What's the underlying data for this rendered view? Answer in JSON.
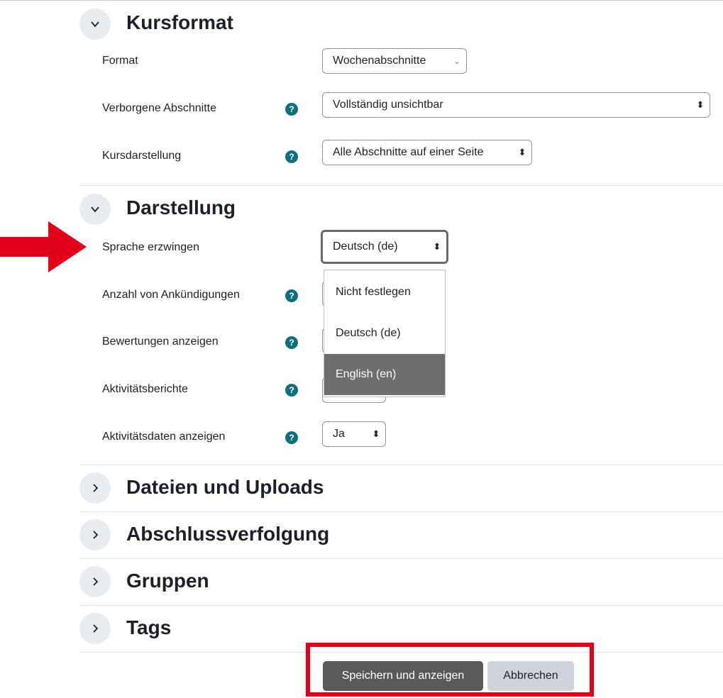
{
  "sections": {
    "kursformat": {
      "title": "Kursformat",
      "expanded": true
    },
    "darstellung": {
      "title": "Darstellung",
      "expanded": true
    },
    "dateien": {
      "title": "Dateien und Uploads",
      "expanded": false
    },
    "abschluss": {
      "title": "Abschlussverfolgung",
      "expanded": false
    },
    "gruppen": {
      "title": "Gruppen",
      "expanded": false
    },
    "tags": {
      "title": "Tags",
      "expanded": false
    }
  },
  "fields": {
    "format": {
      "label": "Format",
      "value": "Wochenabschnitte"
    },
    "verborgene": {
      "label": "Verborgene Abschnitte",
      "value": "Vollständig unsichtbar"
    },
    "kursdarstellung": {
      "label": "Kursdarstellung",
      "value": "Alle Abschnitte auf einer Seite"
    },
    "sprache": {
      "label": "Sprache erzwingen",
      "value": "Deutsch (de)"
    },
    "ankuendigungen": {
      "label": "Anzahl von Ankündigungen"
    },
    "bewertungen": {
      "label": "Bewertungen anzeigen"
    },
    "aktivitaetsberichte": {
      "label": "Aktivitätsberichte"
    },
    "aktivitaetsdaten": {
      "label": "Aktivitätsdaten anzeigen",
      "value": "Ja"
    }
  },
  "language_dropdown": {
    "options": [
      "Nicht festlegen",
      "Deutsch (de)",
      "English (en)"
    ],
    "highlighted": "English (en)"
  },
  "help_icon_glyph": "?",
  "buttons": {
    "save": "Speichern und anzeigen",
    "cancel": "Abbrechen"
  },
  "colors": {
    "accent_help": "#0f6f7d",
    "annotation_red": "#e3001b",
    "primary_button": "#595959",
    "secondary_button": "#ced4da"
  }
}
